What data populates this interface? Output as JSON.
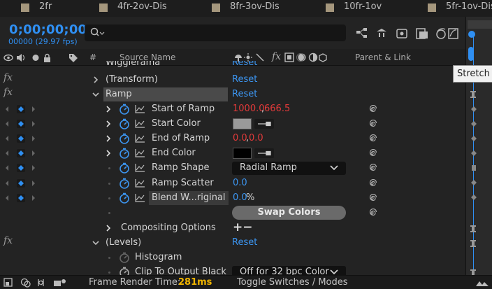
{
  "composition_tabs": [
    "2fr",
    "4fr-2ov-Dis",
    "8fr-3ov-Dis",
    "10fr-1ov",
    "5fr-1ov-Dis"
  ],
  "timecode": "0;00;00;00",
  "frame_info": "00000 (29.97 fps)",
  "search": {
    "placeholder": ""
  },
  "columns": {
    "hash": "#",
    "source_name": "Source Name",
    "switches_fx": "fx",
    "parent_link": "Parent & Link"
  },
  "tooltip": "Stretch",
  "rows": {
    "wiggle": {
      "name": "Wigglerama",
      "reset": "Reset"
    },
    "transform": {
      "name": "(Transform)",
      "reset": "Reset",
      "fx": "fx"
    },
    "ramp": {
      "name": "Ramp",
      "reset": "Reset",
      "fx": "fx"
    },
    "start_of_ramp": {
      "name": "Start of Ramp",
      "x": "1000.0",
      "comma": ",",
      "y": "666.5"
    },
    "start_color": {
      "name": "Start Color",
      "swatch": "#9a9a9a"
    },
    "end_of_ramp": {
      "name": "End of Ramp",
      "x": "0.0",
      "comma": ",",
      "y": "0.0"
    },
    "end_color": {
      "name": "End Color",
      "swatch": "#000000"
    },
    "ramp_shape": {
      "name": "Ramp Shape",
      "value": "Radial Ramp"
    },
    "ramp_scatter": {
      "name": "Ramp Scatter",
      "value": "0.0"
    },
    "blend": {
      "name": "Blend W...riginal",
      "value": "0.0",
      "unit": "%"
    },
    "swap_colors": {
      "label": "Swap Colors"
    },
    "compositing": {
      "name": "Compositing Options",
      "plusminus": "+−"
    },
    "levels": {
      "name": "(Levels)",
      "reset": "Reset",
      "fx": "fx"
    },
    "histogram": {
      "name": "Histogram"
    },
    "clip": {
      "name": "Clip To Output Black",
      "value": "Off for 32 bpc Color"
    }
  },
  "status": {
    "frame_render_label": "Frame Render Time:",
    "frame_render_value": "281ms",
    "toggle_label": "Toggle Switches / Modes"
  },
  "colors": {
    "accent_blue": "#3c95f0",
    "value_red": "#e23a3a",
    "timecode_blue": "#2f8ff2",
    "render_time": "#f0b400"
  }
}
